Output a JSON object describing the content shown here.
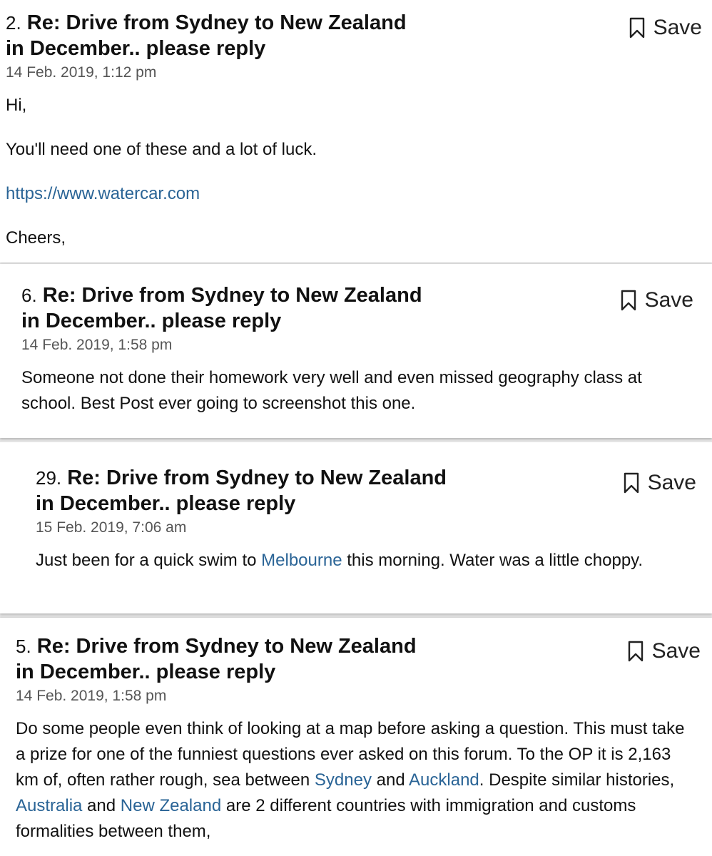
{
  "posts": [
    {
      "number": "2.",
      "title": "Re: Drive from Sydney to New Zealand in December.. please reply",
      "date": "14 Feb. 2019, 1:12 pm",
      "save_label": "Save",
      "body": {
        "line1": "Hi,",
        "line2": "You'll need one of these and a lot of luck.",
        "link": "https://www.watercar.com",
        "line4": "Cheers,"
      }
    },
    {
      "number": "6.",
      "title": "Re: Drive from Sydney to New Zealand in December.. please reply",
      "date": "14 Feb. 2019, 1:58 pm",
      "save_label": "Save",
      "body": {
        "text": "Someone not done their homework very well and even missed geography class at school. Best Post ever going to screenshot this one."
      }
    },
    {
      "number": "29.",
      "title": "Re: Drive from Sydney to New Zealand in December.. please reply",
      "date": "15 Feb. 2019, 7:06 am",
      "save_label": "Save",
      "body": {
        "before_link": "Just been for a quick swim to ",
        "link": "Melbourne",
        "after_link": " this morning. Water was a little choppy."
      }
    },
    {
      "number": "5.",
      "title": "Re: Drive from Sydney to New Zealand in December.. please reply",
      "date": "14 Feb. 2019, 1:58 pm",
      "save_label": "Save",
      "body": {
        "t1": "Do some people even think of looking at a map before asking a question. This must take a prize for one of the funniest questions ever asked on this forum. To the OP it is 2,163 km of, often rather rough, sea between ",
        "link_sydney": "Sydney",
        "t2": " and ",
        "link_auckland": "Auckland",
        "t3": ". Despite similar histories, ",
        "link_australia": "Australia",
        "t4": " and ",
        "link_nz": "New Zealand",
        "t5": " are 2 different countries with immigration and customs formalities between them,"
      }
    }
  ]
}
